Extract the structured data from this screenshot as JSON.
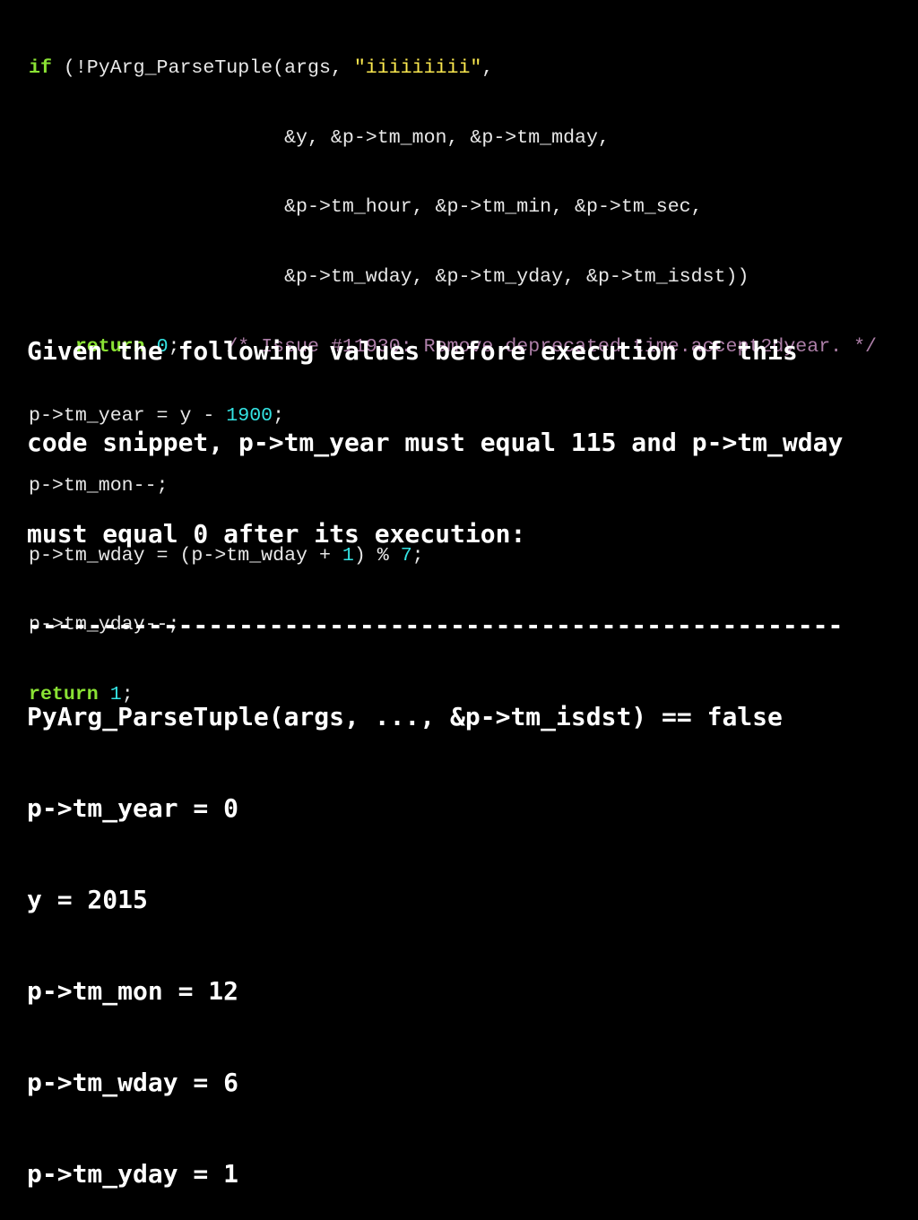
{
  "code": {
    "line1": {
      "kw": "if",
      "pre": " (!PyArg_ParseTuple(args, ",
      "str": "\"iiiiiiiii\"",
      "post": ","
    },
    "line2": "                      &y, &p->tm_mon, &p->tm_mday,",
    "line3": "                      &p->tm_hour, &p->tm_min, &p->tm_sec,",
    "line4": "                      &p->tm_wday, &p->tm_yday, &p->tm_isdst))",
    "line5": {
      "indent": "    ",
      "kw": "return",
      "sp": " ",
      "num": "0",
      "semi": ";    ",
      "comment": "/* Issue #11930: Remove deprecated time.accept2dyear. */"
    },
    "line6": {
      "pre": "p->tm_year = y - ",
      "num": "1900",
      "post": ";"
    },
    "line7": "p->tm_mon--;",
    "line8": {
      "pre": "p->tm_wday = (p->tm_wday + ",
      "num1": "1",
      "mid": ") % ",
      "num2": "7",
      "post": ";"
    },
    "line9": "p->tm_yday--;",
    "line10": {
      "kw": "return",
      "sp": " ",
      "num": "1",
      "post": ";"
    }
  },
  "explanation": {
    "question_lines": [
      "Given the following values before execution of this",
      "code snippet, p->tm_year must equal 115 and p->tm_wday",
      "must equal 0 after its execution:"
    ],
    "divider": "------------------------------------------------------",
    "values": [
      "PyArg_ParseTuple(args, ..., &p->tm_isdst) == false",
      "p->tm_year = 0",
      "y = 2015",
      "p->tm_mon = 12",
      "p->tm_wday = 6",
      "p->tm_yday = 1"
    ]
  },
  "colors": {
    "background": "#000000",
    "keyword": "#8ae234",
    "string": "#fce94f",
    "number": "#34e2e2",
    "comment": "#ad7fa8",
    "text": "#e8e8e8"
  }
}
